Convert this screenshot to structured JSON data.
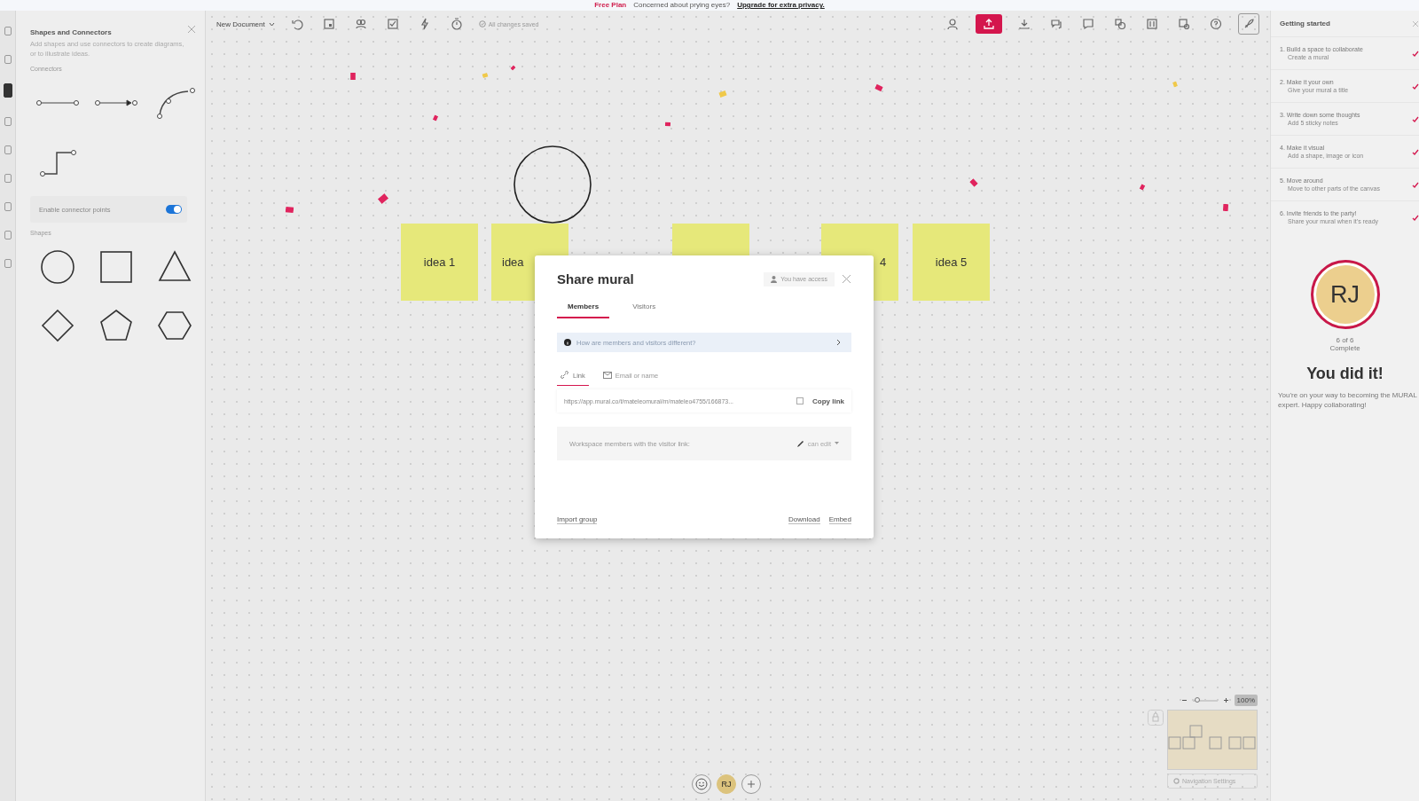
{
  "banner": {
    "plan": "Free Plan",
    "message": "Concerned about prying eyes?",
    "link": "Upgrade for extra privacy."
  },
  "rail": [
    {
      "selected": false
    },
    {
      "selected": false
    },
    {
      "selected": true
    },
    {
      "selected": false
    },
    {
      "selected": false
    },
    {
      "selected": false
    },
    {
      "selected": false
    },
    {
      "selected": false
    },
    {
      "selected": false
    }
  ],
  "shapes_panel": {
    "title": "Shapes and Connectors",
    "description": "Add shapes and use connectors to create diagrams, or to illustrate ideas.",
    "connectors_heading": "Connectors",
    "connectors": [
      {
        "kind": "straight"
      },
      {
        "kind": "arrow"
      },
      {
        "kind": "curved"
      },
      {
        "kind": "elbow"
      }
    ],
    "toggle": {
      "label": "Enable connector points",
      "on": true
    },
    "shapes_heading": "Shapes",
    "shapes": [
      {
        "kind": "circle"
      },
      {
        "kind": "square"
      },
      {
        "kind": "triangle"
      },
      {
        "kind": "diamond"
      },
      {
        "kind": "pentagon"
      },
      {
        "kind": "hexagon"
      }
    ]
  },
  "toolbar": {
    "document": "New Document",
    "status": "All changes saved"
  },
  "canvas": {
    "stickies": [
      {
        "kind": "sticky",
        "text": "idea 1"
      },
      {
        "kind": "sticky",
        "text": "idea"
      },
      {
        "kind": "sticky"
      },
      {
        "kind": "sticky",
        "text": "4"
      },
      {
        "kind": "sticky",
        "text": "idea 5"
      }
    ]
  },
  "dialog": {
    "title": "Share mural",
    "access": "You have access",
    "tabs": [
      {
        "label": "Members",
        "selected": true
      },
      {
        "label": "Visitors",
        "selected": false
      }
    ],
    "info": "How are members and visitors different?",
    "share_tabs": [
      {
        "label": "Link",
        "kind": "link",
        "selected": true
      },
      {
        "label": "Email or name",
        "kind": "email",
        "selected": false
      }
    ],
    "url": "https://app.mural.co/t/mateleomural/m/mateleo4755/166873...",
    "copy": "Copy link",
    "permission_label": "Workspace members with the visitor link:",
    "permission": "can edit",
    "footer_left": "Import group",
    "footer_links": [
      "Download",
      "Embed"
    ]
  },
  "getting_started": {
    "title": "Getting started",
    "steps": [
      {
        "title": "1. Build a space to collaborate",
        "subtitle": "Create a mural",
        "done": true
      },
      {
        "title": "2. Make it your own",
        "subtitle": "Give your mural a title",
        "done": true
      },
      {
        "title": "3. Write down some thoughts",
        "subtitle": "Add 5 sticky notes",
        "done": true
      },
      {
        "title": "4. Make it visual",
        "subtitle": "Add a shape, image or icon",
        "done": true
      },
      {
        "title": "5. Move around",
        "subtitle": "Move to other parts of the canvas",
        "done": true
      },
      {
        "title": "6. Invite friends to the party!",
        "subtitle": "Share your mural when it's ready",
        "done": true
      }
    ],
    "avatar": "RJ",
    "progress": "6 of 6",
    "progress_label": "Complete",
    "headline": "You did it!",
    "message": "You're on your way to becoming the MURAL expert. Happy collaborating!"
  },
  "bottom_bar": {
    "avatar": "RJ"
  },
  "navigator": {
    "zoom_slider": {
      "level": 0.2
    },
    "zoom": "100%",
    "settings": "Navigation Settings"
  }
}
